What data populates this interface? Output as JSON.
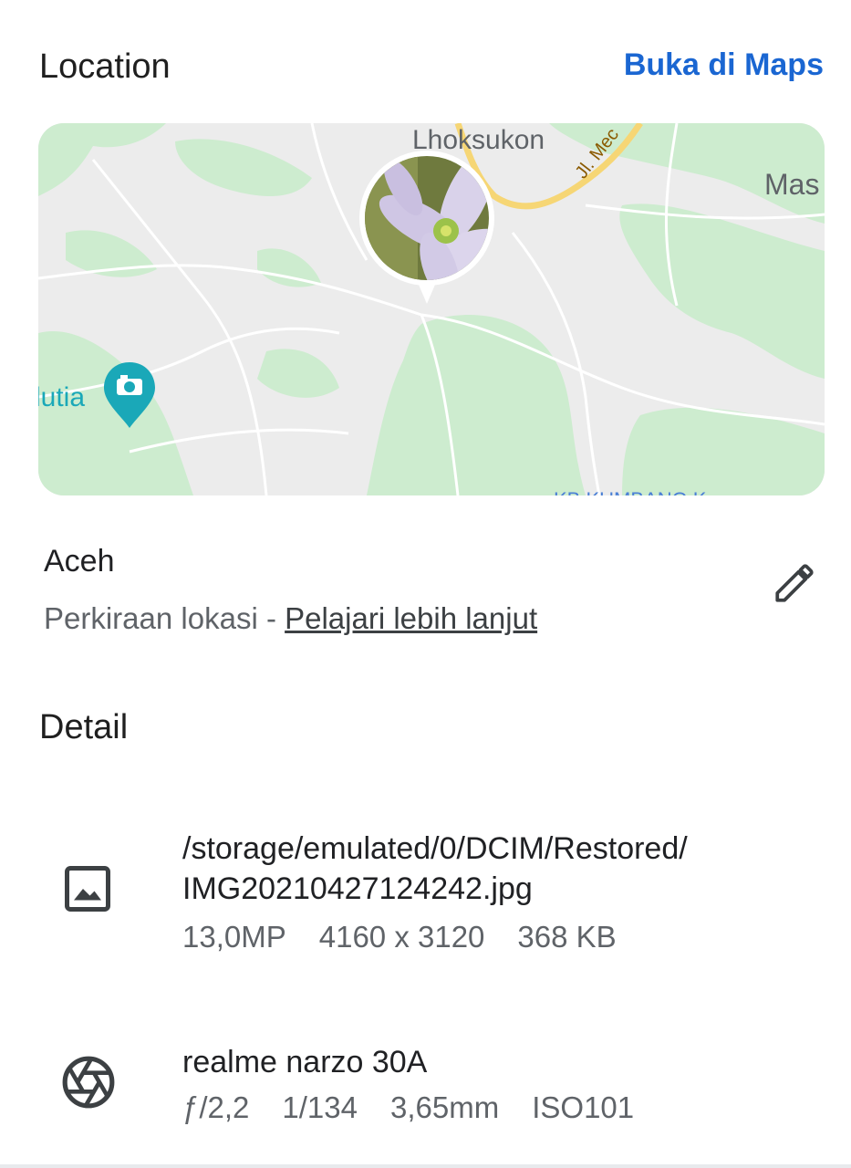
{
  "location": {
    "title": "Location",
    "open_maps_label": "Buka di Maps",
    "map": {
      "label_town": "Lhoksukon",
      "label_road": "Jl. Mec",
      "label_right": "Mas",
      "label_left": "lutia",
      "label_bottom": "KB KUMBANG K",
      "colors": {
        "land": "#ececec",
        "green": "#cdeccf",
        "road_major": "#f6d675",
        "poi": "#1aa8b8"
      }
    },
    "place_name": "Aceh",
    "approx_text": "Perkiraan lokasi - ",
    "learn_more": "Pelajari lebih lanjut",
    "edit_icon": "pencil-icon"
  },
  "detail": {
    "title": "Detail",
    "file": {
      "icon": "image-icon",
      "path_line1": "/storage/emulated/0/DCIM/Restored/",
      "path_line2": "IMG20210427124242.jpg",
      "megapixels": "13,0MP",
      "resolution": "4160 x 3120",
      "size": "368 KB"
    },
    "camera": {
      "icon": "aperture-icon",
      "model": "realme narzo 30A",
      "aperture": "ƒ/2,2",
      "shutter": "1/134",
      "focal": "3,65mm",
      "iso": "ISO101"
    }
  }
}
